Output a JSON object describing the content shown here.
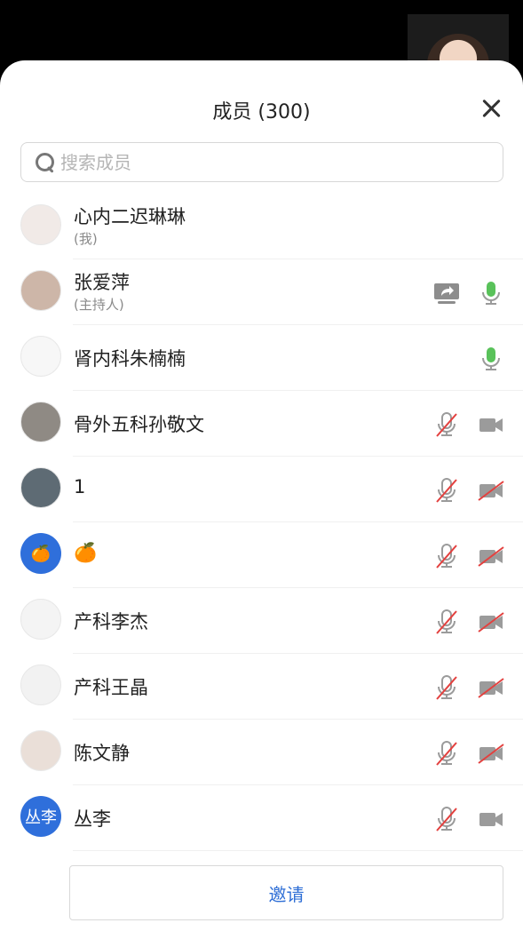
{
  "header": {
    "title": "成员 (300)"
  },
  "search": {
    "placeholder": "搜索成员"
  },
  "members": [
    {
      "name": "心内二迟琳琳",
      "role": "(我)",
      "avatar_bg": "#f1eae7",
      "controls": []
    },
    {
      "name": "张爱萍",
      "role": "(主持人)",
      "avatar_bg": "#cdb6a8",
      "controls": [
        "screen-share-icon",
        "mic-on-icon"
      ]
    },
    {
      "name": "肾内科朱楠楠",
      "role": "",
      "avatar_bg": "#f7f7f7",
      "controls": [
        "mic-on-icon"
      ]
    },
    {
      "name": "骨外五科孙敬文",
      "role": "",
      "avatar_bg": "#8f8a84",
      "controls": [
        "mic-muted-icon",
        "camera-on-icon"
      ]
    },
    {
      "name": "1",
      "role": "",
      "avatar_bg": "#5e6b74",
      "controls": [
        "mic-muted-icon",
        "camera-off-icon"
      ]
    },
    {
      "name": "🍊",
      "role": "",
      "avatar_bg": "#2f6fdb",
      "avatar_text": "🍊",
      "controls": [
        "mic-muted-icon",
        "camera-off-icon"
      ]
    },
    {
      "name": "产科李杰",
      "role": "",
      "avatar_bg": "#f4f4f4",
      "controls": [
        "mic-muted-icon",
        "camera-off-icon"
      ]
    },
    {
      "name": "产科王晶",
      "role": "",
      "avatar_bg": "#f2f2f2",
      "controls": [
        "mic-muted-icon",
        "camera-off-icon"
      ]
    },
    {
      "name": "陈文静",
      "role": "",
      "avatar_bg": "#eadfd8",
      "controls": [
        "mic-muted-icon",
        "camera-off-icon"
      ]
    },
    {
      "name": "丛李",
      "role": "",
      "avatar_bg": "#2f6fdb",
      "avatar_text": "丛李",
      "controls": [
        "mic-muted-icon",
        "camera-on-icon"
      ]
    }
  ],
  "footer": {
    "invite_label": "邀请"
  },
  "colors": {
    "accent": "#2f6fd6",
    "mic_on": "#59c25a",
    "muted_slash": "#e3413f",
    "icon_gray": "#9b9b9b"
  }
}
